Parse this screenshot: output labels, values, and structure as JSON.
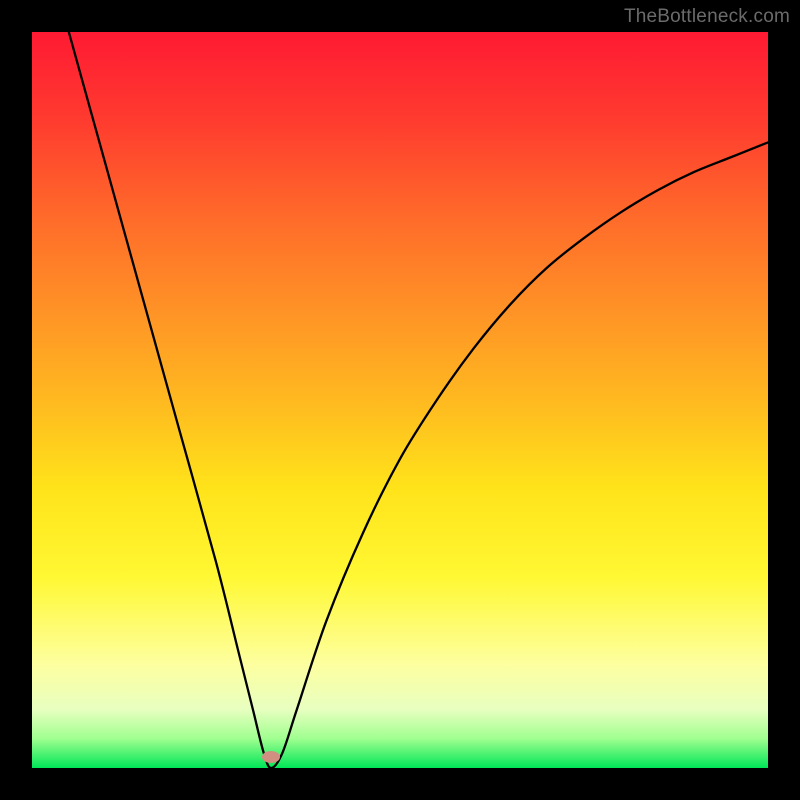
{
  "watermark": "TheBottleneck.com",
  "chart_data": {
    "type": "line",
    "title": "",
    "xlabel": "",
    "ylabel": "",
    "xlim": [
      0,
      100
    ],
    "ylim": [
      0,
      100
    ],
    "grid": false,
    "series": [
      {
        "name": "curve",
        "x": [
          5,
          10,
          15,
          20,
          25,
          28,
          30,
          31.5,
          32.5,
          34,
          36,
          40,
          45,
          50,
          55,
          60,
          65,
          70,
          75,
          80,
          85,
          90,
          95,
          100
        ],
        "y": [
          100,
          82,
          64,
          46,
          28,
          16,
          8,
          2,
          0,
          2,
          8,
          20,
          32,
          42,
          50,
          57,
          63,
          68,
          72,
          75.5,
          78.5,
          81,
          83,
          85
        ]
      }
    ],
    "marker": {
      "x": 32.5,
      "y": 1.5,
      "color": "#d18f82"
    },
    "gradient_stops": [
      {
        "pos": 0,
        "color": "#ff1a33"
      },
      {
        "pos": 12,
        "color": "#ff3b2f"
      },
      {
        "pos": 25,
        "color": "#ff6a2a"
      },
      {
        "pos": 38,
        "color": "#ff9326"
      },
      {
        "pos": 50,
        "color": "#ffb920"
      },
      {
        "pos": 62,
        "color": "#ffe31a"
      },
      {
        "pos": 74,
        "color": "#fff833"
      },
      {
        "pos": 86,
        "color": "#fdffa0"
      },
      {
        "pos": 92,
        "color": "#e8ffc0"
      },
      {
        "pos": 96,
        "color": "#a0ff90"
      },
      {
        "pos": 100,
        "color": "#00e657"
      }
    ]
  }
}
